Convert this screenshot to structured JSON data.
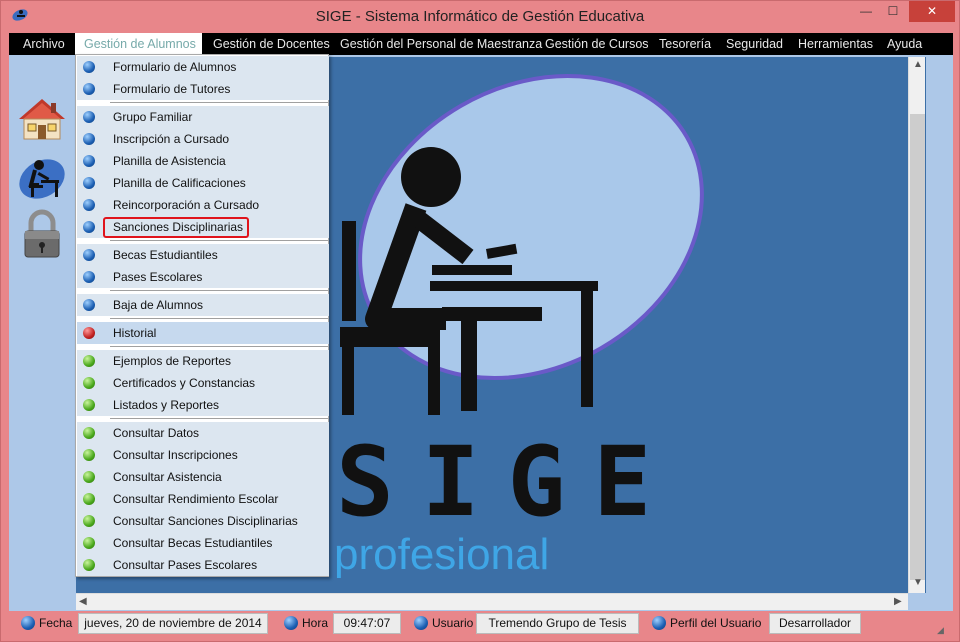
{
  "window": {
    "title": "SIGE - Sistema Informático de Gestión Educativa",
    "minimize": "—",
    "maximize": "☐",
    "close": "✕"
  },
  "menubar": [
    "Archivo",
    "Gestión de Alumnos",
    "Gestión de Docentes",
    "Gestión del Personal de Maestranza",
    "Gestión de Cursos",
    "Tesorería",
    "Seguridad",
    "Herramientas",
    "Ayuda"
  ],
  "left_toolbar": {
    "icons": [
      "home-icon",
      "student-icon",
      "lock-icon"
    ]
  },
  "dropdown": [
    {
      "label": "Formulario de Alumnos",
      "color": "blue"
    },
    {
      "label": "Formulario de Tutores",
      "color": "blue"
    },
    {
      "label": "Grupo Familiar",
      "color": "blue"
    },
    {
      "label": "Inscripción a Cursado",
      "color": "blue"
    },
    {
      "label": "Planilla de Asistencia",
      "color": "blue"
    },
    {
      "label": "Planilla de Calificaciones",
      "color": "blue"
    },
    {
      "label": "Reincorporación a Cursado",
      "color": "blue"
    },
    {
      "label": "Sanciones Disciplinarias",
      "color": "blue",
      "outlined": true
    },
    {
      "label": "Becas Estudiantiles",
      "color": "blue"
    },
    {
      "label": "Pases Escolares",
      "color": "blue"
    },
    {
      "label": "Baja de Alumnos",
      "color": "blue"
    },
    {
      "label": "Historial",
      "color": "red"
    },
    {
      "label": "Ejemplos de Reportes",
      "color": "green"
    },
    {
      "label": "Certificados y Constancias",
      "color": "green"
    },
    {
      "label": "Listados y Reportes",
      "color": "green"
    },
    {
      "label": "Consultar Datos",
      "color": "green"
    },
    {
      "label": "Consultar Inscripciones",
      "color": "green"
    },
    {
      "label": "Consultar Asistencia",
      "color": "green"
    },
    {
      "label": "Consultar Rendimiento Escolar",
      "color": "green"
    },
    {
      "label": "Consultar Sanciones Disciplinarias",
      "color": "green"
    },
    {
      "label": "Consultar Becas Estudiantiles",
      "color": "green"
    },
    {
      "label": "Consultar Pases Escolares",
      "color": "green"
    }
  ],
  "background_logo": {
    "wordmark": "SIGE",
    "tagline": "profesional"
  },
  "statusbar": {
    "fecha_label": "Fecha",
    "fecha_value": "jueves, 20 de noviembre de 2014",
    "hora_label": "Hora",
    "hora_value": "09:47:07",
    "usuario_label": "Usuario",
    "usuario_value": "Tremendo Grupo de Tesis",
    "perfil_label": "Perfil del Usuario",
    "perfil_value": "Desarrollador"
  },
  "colors": {
    "titlebar": "#e8868a",
    "menubar": "#000000",
    "mdi_background": "#3c6fa6",
    "menu_panel": "#dce6f0",
    "highlight_box": "#e0141c"
  }
}
